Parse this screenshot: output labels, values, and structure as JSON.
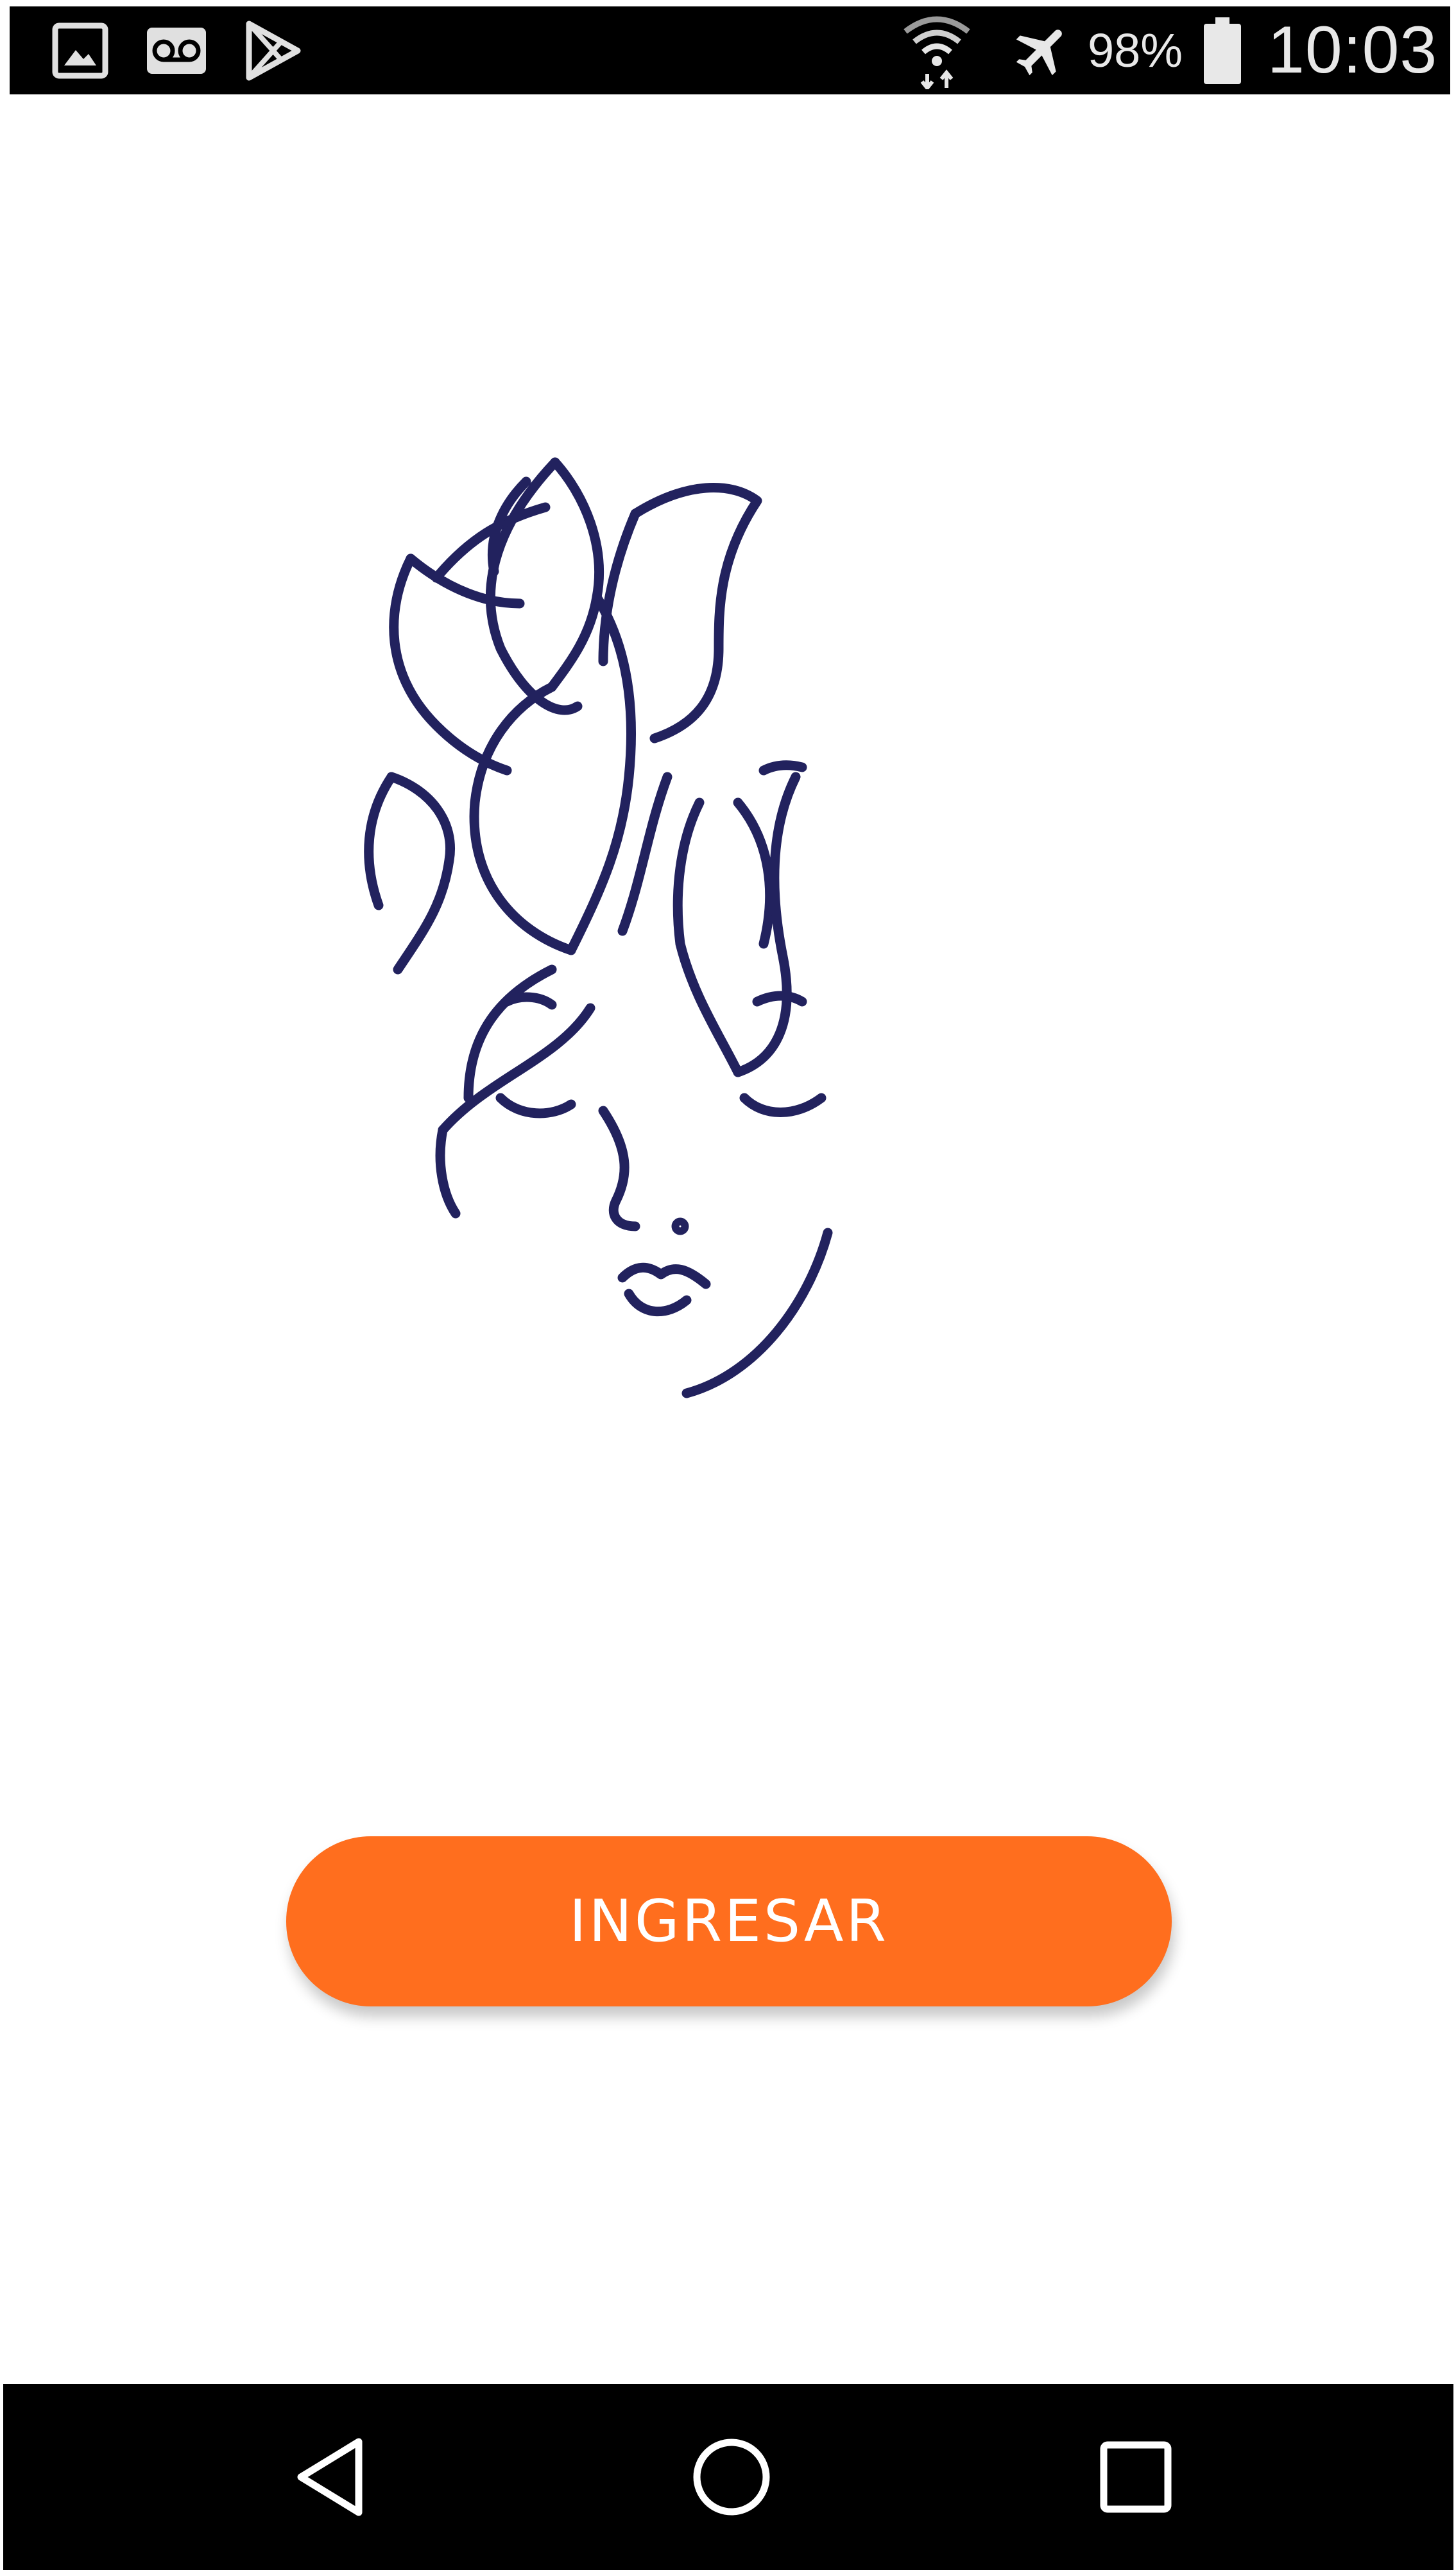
{
  "status_bar": {
    "left_icons": [
      "gallery-icon",
      "voicemail-icon",
      "play-store-icon"
    ],
    "right_icons": [
      "wifi-icon",
      "airplane-mode-icon",
      "battery-icon"
    ],
    "battery_percent": "98%",
    "time": "10:03"
  },
  "main": {
    "logo_icon": "woman-face-flame-hair-logo",
    "logo_color": "#22225e",
    "login_button_label": "INGRESAR",
    "login_button_color": "#ff6e1e"
  },
  "nav_bar": {
    "buttons": [
      "back-icon",
      "home-icon",
      "recents-icon"
    ]
  }
}
